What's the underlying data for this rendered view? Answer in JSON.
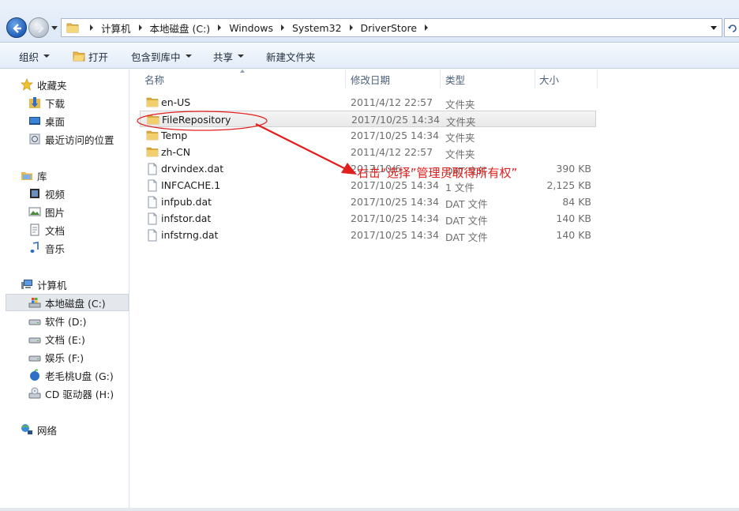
{
  "address_bar": {
    "crumbs": [
      "计算机",
      "本地磁盘 (C:)",
      "Windows",
      "System32",
      "DriverStore"
    ]
  },
  "toolbar": {
    "organize": "组织",
    "open": "打开",
    "include_in_library": "包含到库中",
    "share": "共享",
    "new_folder": "新建文件夹"
  },
  "sidebar": {
    "favorites": "收藏夹",
    "downloads": "下载",
    "desktop": "桌面",
    "recent": "最近访问的位置",
    "libraries": "库",
    "videos": "视频",
    "pictures": "图片",
    "documents": "文档",
    "music": "音乐",
    "computer": "计算机",
    "drive_c": "本地磁盘 (C:)",
    "drive_d": "软件 (D:)",
    "drive_e": "文档 (E:)",
    "drive_f": "娱乐 (F:)",
    "drive_g": "老毛桃U盘 (G:)",
    "drive_h": "CD 驱动器 (H:)",
    "network": "网络"
  },
  "columns": {
    "name": "名称",
    "date": "修改日期",
    "type": "类型",
    "size": "大小"
  },
  "files": [
    {
      "name": "en-US",
      "date": "2011/4/12 22:57",
      "type": "文件夹",
      "size": "",
      "kind": "folder"
    },
    {
      "name": "FileRepository",
      "date": "2017/10/25 14:34",
      "type": "文件夹",
      "size": "",
      "kind": "folder"
    },
    {
      "name": "Temp",
      "date": "2017/10/25 14:34",
      "type": "文件夹",
      "size": "",
      "kind": "folder"
    },
    {
      "name": "zh-CN",
      "date": "2011/4/12 22:57",
      "type": "文件夹",
      "size": "",
      "kind": "folder"
    },
    {
      "name": "drvindex.dat",
      "date": "2017/10/6 ...",
      "type": "DAT 文件",
      "size": "390 KB",
      "kind": "file"
    },
    {
      "name": "INFCACHE.1",
      "date": "2017/10/25 14:34",
      "type": "1 文件",
      "size": "2,125 KB",
      "kind": "file"
    },
    {
      "name": "infpub.dat",
      "date": "2017/10/25 14:34",
      "type": "DAT 文件",
      "size": "84 KB",
      "kind": "file"
    },
    {
      "name": "infstor.dat",
      "date": "2017/10/25 14:34",
      "type": "DAT 文件",
      "size": "140 KB",
      "kind": "file"
    },
    {
      "name": "infstrng.dat",
      "date": "2017/10/25 14:34",
      "type": "DAT 文件",
      "size": "140 KB",
      "kind": "file"
    }
  ],
  "annotation": {
    "text": "右击“选择”管理员取得所有权”",
    "color": "#e0201e"
  },
  "selected_file_index": 1
}
